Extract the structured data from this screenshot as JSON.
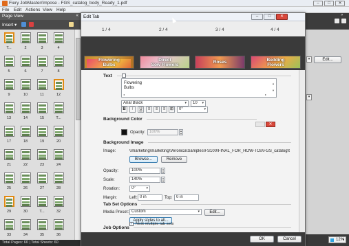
{
  "app": {
    "title": "Fiery JobMaster/Impose - FGS_catalog_body_Ready_1.pdf",
    "menu": [
      "File",
      "Edit",
      "Actions",
      "View",
      "Help"
    ],
    "window_buttons": [
      "–",
      "□",
      "✕"
    ]
  },
  "page_view": {
    "header": "Page View",
    "collapse": "«",
    "insert_label": "Insert ▾",
    "thumb_labels": [
      "T...",
      "2",
      "3",
      "4",
      "5",
      "6",
      "7",
      "8",
      "9",
      "10",
      "11",
      "12",
      "13",
      "14",
      "15",
      "T...",
      "17",
      "18",
      "19",
      "20",
      "21",
      "22",
      "23",
      "24",
      "25",
      "26",
      "27",
      "28",
      "29",
      "30",
      "T...",
      "32",
      "33",
      "34",
      "35",
      "36"
    ],
    "status": "Total Pages: 60 | Total Sheets: 60"
  },
  "right_area": {
    "edit_label": "Edit...",
    "zoom": "12%"
  },
  "dialog": {
    "title": "Edit Tab",
    "pager": [
      "1 / 4",
      "2 / 4",
      "3 / 4",
      "4 / 4"
    ],
    "tabs": [
      {
        "text": "Flowering\nBulbs"
      },
      {
        "text": "Direct\nSow Flowers"
      },
      {
        "text": "Roses"
      },
      {
        "text": "Bedding\nFlowers"
      }
    ],
    "text_section": {
      "title": "Text",
      "lines": [
        "Flowering",
        "Bulbs"
      ],
      "font": "Arial Black",
      "size": "10",
      "bold": "B",
      "italic": "I",
      "underline": "U",
      "angle": "0°"
    },
    "bg_color": {
      "title": "Background Color",
      "opacity_label": "Opacity:",
      "opacity_value": "100%",
      "checked": true
    },
    "bg_image": {
      "title": "Background Image",
      "image_label": "Image:",
      "image_path": "\\\\marketing\\marketing\\Veronica\\Samples\\FS100\\FINAL_FOR_HOW-TOs\\FGS_catalog\\t",
      "browse": "Browse...",
      "remove": "Remove",
      "opacity_label": "Opacity:",
      "opacity_value": "100%",
      "scale_label": "Scale:",
      "scale_value": "140%",
      "rotation_label": "Rotation:",
      "rotation_value": "0°",
      "margin_label": "Margin:",
      "left_label": "Left:",
      "left_value": "0 in",
      "top_label": "Top:",
      "top_value": "0 in"
    },
    "tab_set": {
      "title": "Tab Set Options",
      "media_preset_label": "Media Preset:",
      "media_preset_value": "Custom",
      "edit": "Edit...",
      "apply": "Apply styles to all..."
    },
    "job_options": {
      "title": "Job Options",
      "nest_label": "Nest multiple tab sets",
      "nest_checked": true
    },
    "ok": "OK",
    "cancel": "Cancel"
  }
}
